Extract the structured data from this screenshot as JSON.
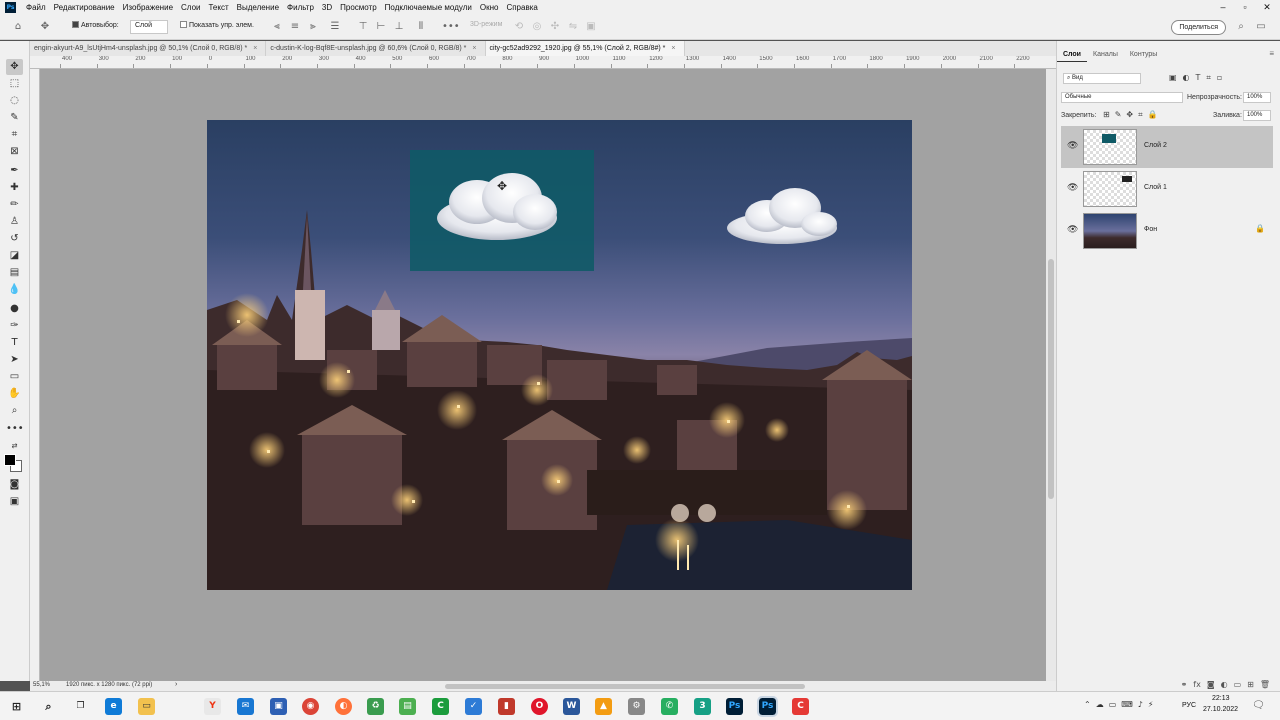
{
  "menu": {
    "items": [
      "Файл",
      "Редактирование",
      "Изображение",
      "Слои",
      "Текст",
      "Выделение",
      "Фильтр",
      "3D",
      "Просмотр",
      "Подключаемые модули",
      "Окно",
      "Справка"
    ]
  },
  "options": {
    "autoselect_label": "Автовыбор:",
    "autoselect_value": "Слой",
    "show_transform": "Показать упр. элем.",
    "mode_3d": "3D-режим",
    "share": "Поделиться"
  },
  "tabs": [
    {
      "label": "engin-akyurt-A9_lsUtjHm4-unsplash.jpg @ 50,1% (Слой 0, RGB/8) *"
    },
    {
      "label": "c-dustin-K-log-Bqf8E-unsplash.jpg @ 60,6% (Слой 0, RGB/8) *"
    },
    {
      "label": "city-gc52ad9292_1920.jpg @ 55,1% (Слой 2, RGB/8#) *"
    }
  ],
  "ruler": {
    "labels": [
      "400",
      "300",
      "200",
      "100",
      "0",
      "100",
      "200",
      "300",
      "400",
      "500",
      "600",
      "700",
      "800",
      "900",
      "1000",
      "1100",
      "1200",
      "1300",
      "1400",
      "1500",
      "1600",
      "1700",
      "1800",
      "1900",
      "2000",
      "2100",
      "2200"
    ]
  },
  "status": {
    "zoom": "55,1%",
    "doc": "1920 пикс. x 1280 пикс. (72 ppi)"
  },
  "panel": {
    "tabs": [
      "Слои",
      "Каналы",
      "Контуры"
    ],
    "filter": "Вид",
    "blend": "Обычные",
    "opacity_label": "Непрозрачность:",
    "opacity_value": "100%",
    "lock_label": "Закрепить:",
    "fill_label": "Заливка:",
    "fill_value": "100%",
    "layers": [
      {
        "name": "Слой 2"
      },
      {
        "name": "Слой 1"
      },
      {
        "name": "Фон"
      }
    ]
  },
  "taskbar": {
    "lang": "РУС",
    "time": "22:13",
    "date": "27.10.2022"
  },
  "colors": {
    "accent": "#31a8ff",
    "selection": "#0f5a66"
  }
}
